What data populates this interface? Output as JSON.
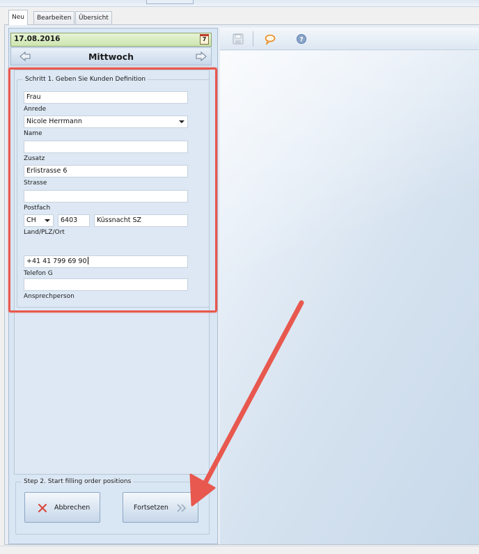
{
  "tabs": [
    {
      "label": "Neu",
      "active": true
    },
    {
      "label": "Bearbeiten",
      "active": false
    },
    {
      "label": "Übersicht",
      "active": false
    }
  ],
  "date_bar": {
    "date": "17.08.2016",
    "calendar_icon": "calendar-icon",
    "calendar_day": "7"
  },
  "day_nav": {
    "day": "Mittwoch",
    "prev_icon": "arrow-left-icon",
    "next_icon": "arrow-right-icon"
  },
  "step1": {
    "legend": "Schritt 1. Geben Sie Kunden Definition",
    "fields": {
      "anrede": {
        "value": "Frau",
        "label": "Anrede"
      },
      "name": {
        "value": "Nicole Herrmann",
        "label": "Name"
      },
      "zusatz": {
        "value": "",
        "label": "Zusatz"
      },
      "strasse": {
        "value": "Erlistrasse 6",
        "label": "Strasse"
      },
      "postfach": {
        "value": "",
        "label": "Postfach"
      },
      "land": {
        "value": "CH"
      },
      "plz": {
        "value": "6403"
      },
      "ort": {
        "value": "Küssnacht SZ"
      },
      "land_plz_ort_label": "Land/PLZ/Ort",
      "telefon": {
        "value": "+41 41 799 69 90",
        "label": "Telefon G"
      },
      "ansprechperson": {
        "value": "",
        "label": "Ansprechperson"
      }
    }
  },
  "step2": {
    "legend": "Step 2. Start filling order positions",
    "cancel": {
      "label": "Abbrechen",
      "icon": "red-x-icon"
    },
    "continue": {
      "label": "Fortsetzen",
      "icon": "double-chevron-right-icon"
    }
  },
  "toolbar": {
    "icons": [
      "save-icon",
      "comment-icon",
      "help-icon"
    ]
  },
  "colors": {
    "highlight": "#e8584e",
    "date_bar": "#d6ecbf",
    "panel": "#dde8f4",
    "accent": "#5b7fb5"
  }
}
